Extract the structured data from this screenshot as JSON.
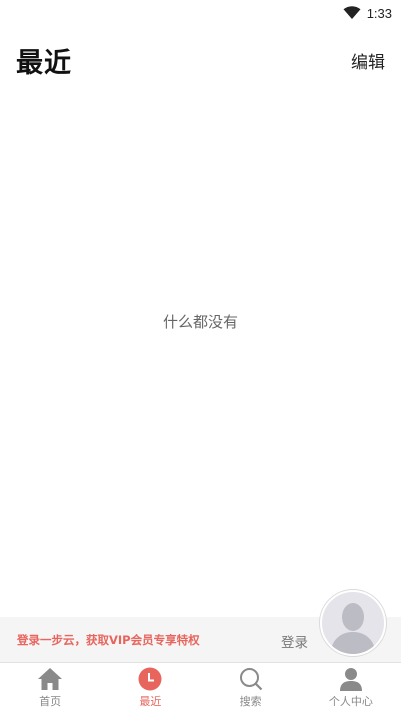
{
  "status_bar": {
    "time": "1:33",
    "wifi_icon": "wifi-icon"
  },
  "header": {
    "title": "最近",
    "edit_label": "编辑"
  },
  "empty_state": {
    "message": "什么都没有"
  },
  "login_banner": {
    "promo_text": "登录一步云，获取VIP会员专享特权",
    "login_label": "登录"
  },
  "tab_bar": {
    "tabs": [
      {
        "label": "首页",
        "icon": "home-icon",
        "active": false
      },
      {
        "label": "最近",
        "icon": "clock-icon",
        "active": true
      },
      {
        "label": "搜索",
        "icon": "search-icon",
        "active": false
      },
      {
        "label": "个人中心",
        "icon": "user-icon",
        "active": false
      }
    ]
  },
  "colors": {
    "accent": "#e8655d",
    "inactive": "#888888",
    "banner_bg": "#f5f5f5"
  }
}
